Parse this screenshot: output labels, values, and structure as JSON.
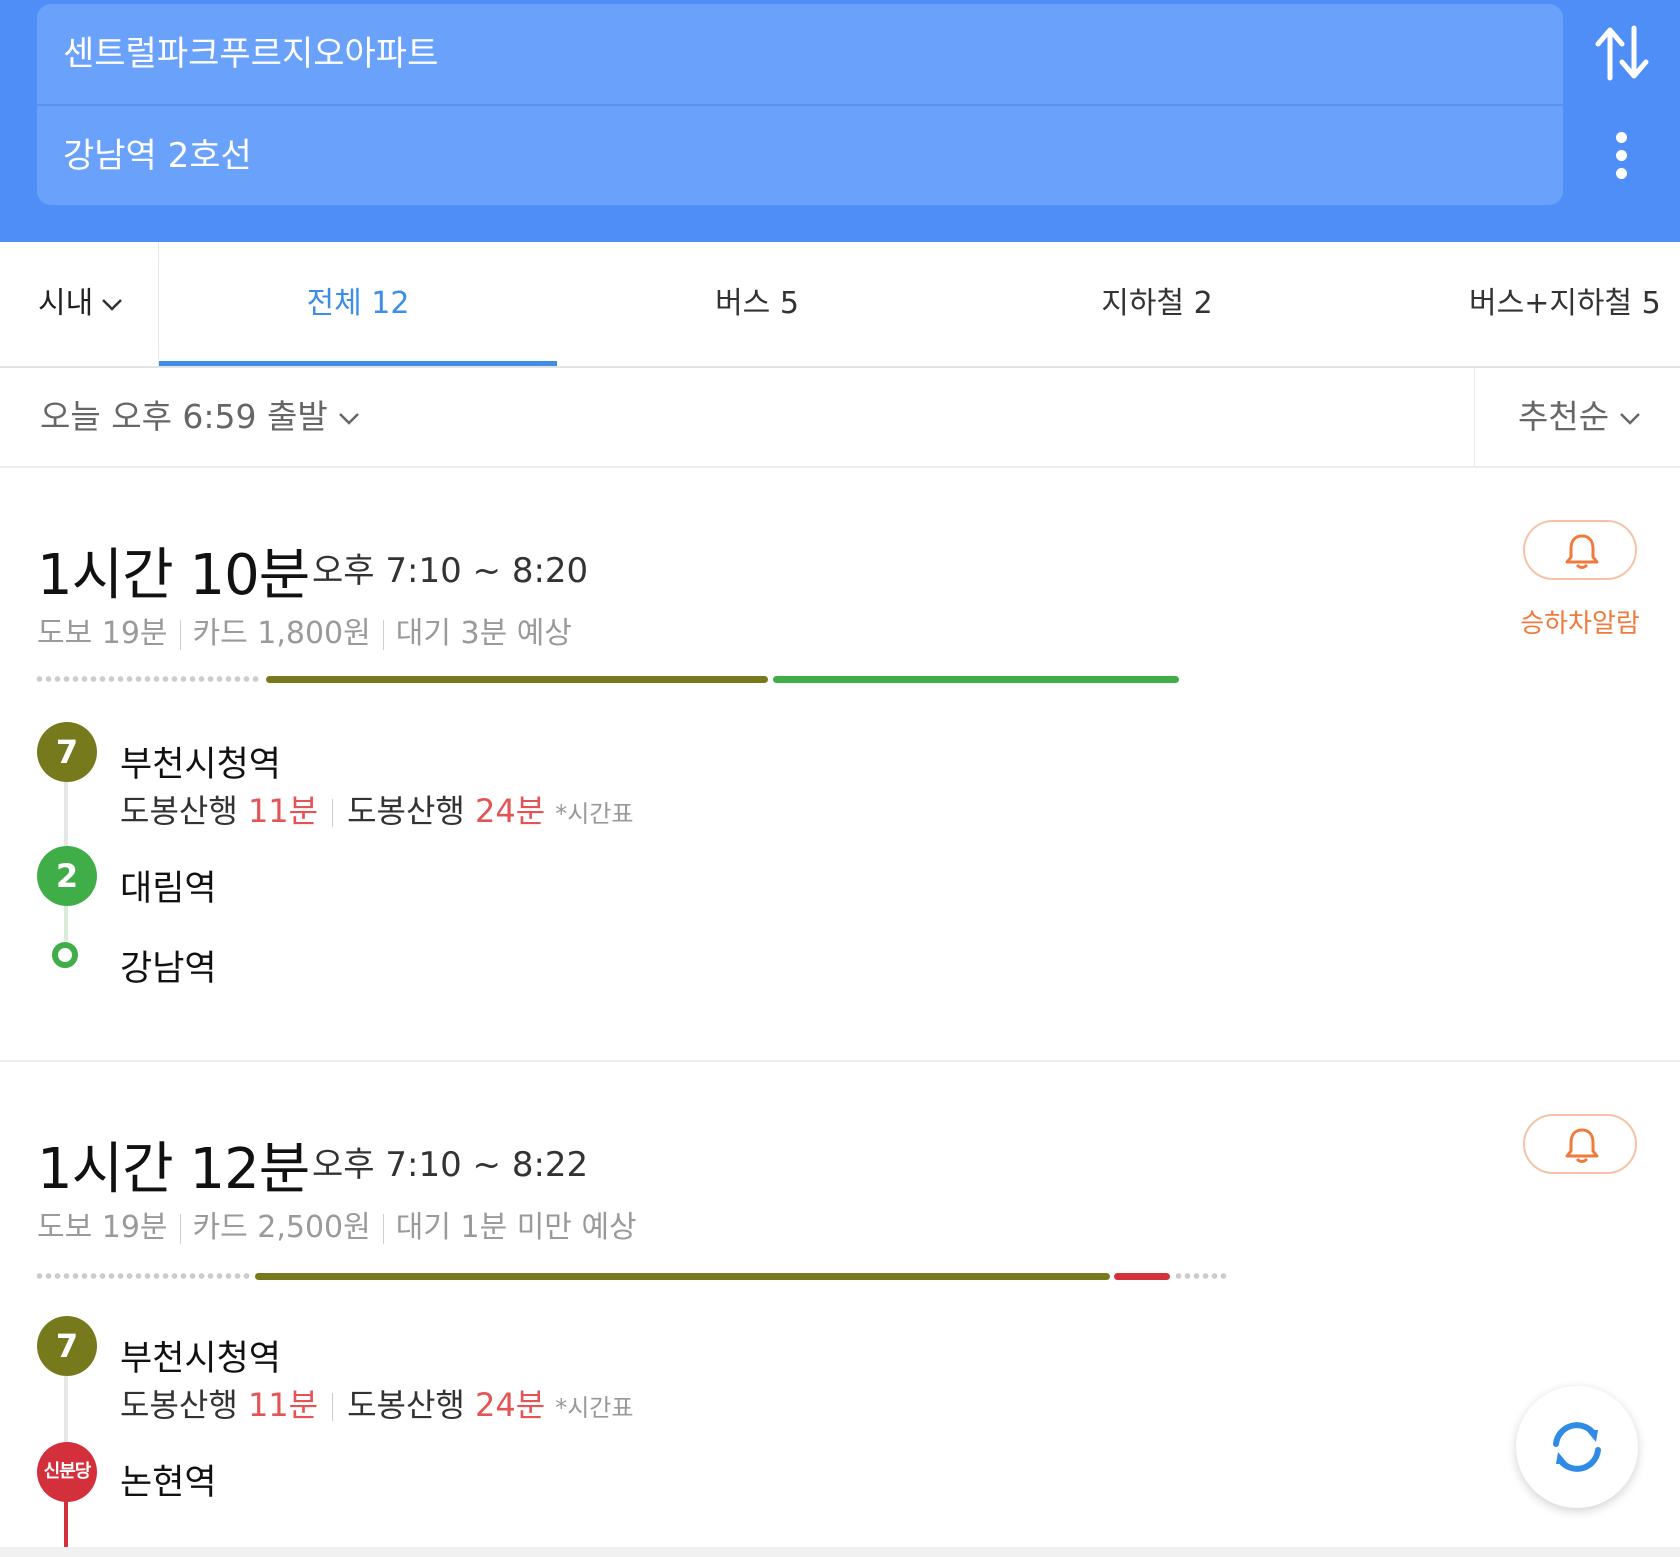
{
  "search": {
    "origin": "센트럴파크푸르지오아파트",
    "destination": "강남역 2호선",
    "swap_icon": "swap-vertical-icon",
    "more_icon": "more-vertical-icon"
  },
  "tabs": {
    "region": "시내",
    "items": [
      {
        "label": "전체 12",
        "active": true
      },
      {
        "label": "버스 5",
        "active": false
      },
      {
        "label": "지하철 2",
        "active": false
      },
      {
        "label": "버스+지하철 5",
        "active": false
      }
    ]
  },
  "filter": {
    "departure": "오늘 오후 6:59 출발",
    "sort": "추천순"
  },
  "colors": {
    "header": "#4f8ef6",
    "accent": "#3d8ee8",
    "line7": "#767a1c",
    "line2": "#3fae49",
    "shinbundang": "#d4303b",
    "alarm": "#f07a3b",
    "arrival": "#e45454"
  },
  "routes": [
    {
      "duration": "1시간 10분",
      "time_range": "오후 7:10 ~ 8:20",
      "walk": "도보 19분",
      "fare": "카드 1,800원",
      "wait": "대기 3분 예상",
      "alarm_label": "승하차알람",
      "steps": [
        {
          "badge": "7",
          "station": "부천시청역",
          "arrivals": [
            {
              "dest": "도봉산행",
              "min": "11분"
            },
            {
              "dest": "도봉산행",
              "min": "24분"
            }
          ],
          "timetable": "*시간표"
        },
        {
          "badge": "2",
          "station": "대림역"
        },
        {
          "station": "강남역"
        }
      ]
    },
    {
      "duration": "1시간 12분",
      "time_range": "오후 7:10 ~ 8:22",
      "walk": "도보 19분",
      "fare": "카드 2,500원",
      "wait": "대기 1분 미만 예상",
      "steps": [
        {
          "badge": "7",
          "station": "부천시청역",
          "arrivals": [
            {
              "dest": "도봉산행",
              "min": "11분"
            },
            {
              "dest": "도봉산행",
              "min": "24분"
            }
          ],
          "timetable": "*시간표"
        },
        {
          "badge": "신분당",
          "station": "논현역"
        }
      ]
    }
  ],
  "fab": {
    "refresh_icon": "refresh-icon"
  }
}
